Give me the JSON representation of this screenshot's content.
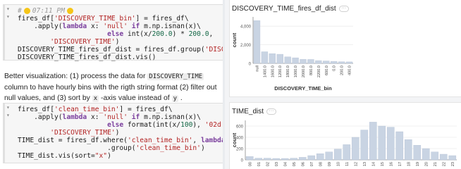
{
  "cell1": {
    "comment_time": "07:11 PM",
    "lines": [
      [
        "fires_df[",
        {
          "s": "'DISCOVERY_TIME_bin'"
        },
        "] = fires_df\\"
      ],
      [
        "    .apply(",
        {
          "k": "lambda"
        },
        " x: ",
        {
          "s": "'null'"
        },
        " ",
        {
          "k": "if"
        },
        " m.np.isnan(x)\\"
      ],
      [
        "                      ",
        {
          "k": "else"
        },
        " int(x/",
        {
          "n": "200.0"
        },
        ") * ",
        {
          "n": "200.0"
        },
        ","
      ],
      [
        "        ",
        {
          "s": "'DISCOVERY_TIME'"
        },
        ")"
      ],
      [
        "DISCOVERY_TIME_fires_df_dist = fires_df.group(",
        {
          "s": "'DISCOVERY"
        }
      ],
      [
        "DISCOVERY_TIME_fires_df_dist.vis()"
      ]
    ]
  },
  "markdown": {
    "t1": "Better visualization: (1) process the data for ",
    "c1": "DISCOVERY_TIME",
    "t2": " column to have hourly bins with the rigth string format (2) filter out null values, and (3) sort by ",
    "c2": "x",
    "t3": " -axis value instead of ",
    "c3": "y",
    "t4": " ."
  },
  "cell2": {
    "lines": [
      [
        "fires_df[",
        {
          "s": "'clean_time_bin'"
        },
        "] = fires_df\\"
      ],
      [
        "    .apply(",
        {
          "k": "lambda"
        },
        " x: ",
        {
          "s": "'null'"
        },
        " ",
        {
          "k": "if"
        },
        " m.np.isnan(x)\\"
      ],
      [
        "                      ",
        {
          "k": "else"
        },
        " format(int(x/",
        {
          "n": "100"
        },
        "), ",
        {
          "s": "'02d"
        }
      ],
      [
        "        ",
        {
          "s": "'DISCOVERY_TIME'"
        },
        ")"
      ],
      [
        "TIME_dist = fires_df.where(",
        {
          "s": "'clean_time_bin'"
        },
        ", ",
        {
          "k": "lambda"
        },
        " x: x"
      ],
      [
        "                      .group(",
        {
          "s": "'clean_time_bin'"
        },
        ")"
      ],
      [
        "TIME_dist.vis(sort=",
        {
          "s": "\"x\""
        },
        ")"
      ]
    ]
  },
  "charts": {
    "more_label": "···"
  },
  "colors": {
    "bar": "#c9d4e3",
    "bar_stroke": "#b6c3d6",
    "axis": "#888888"
  },
  "chart_data": [
    {
      "type": "bar",
      "title": "DISCOVERY_TIME_fires_df_dist",
      "xlabel": "DISCOVERY_TIME_bin",
      "ylabel": "count",
      "ylim": [
        0,
        5000
      ],
      "yticks": [
        0,
        2000,
        4000
      ],
      "ytick_labels": [
        "0",
        "2,000",
        "4,000"
      ],
      "categories": [
        "null",
        "1400.0",
        "1600.0",
        "1200.0",
        "1800.0",
        "1000.0",
        "2000.0",
        "800.0",
        "2200.0",
        "600.0",
        "0.0",
        "200.0",
        "400.0"
      ],
      "values": [
        4600,
        1250,
        1050,
        980,
        700,
        600,
        430,
        420,
        300,
        260,
        220,
        180,
        160
      ],
      "grid": true
    },
    {
      "type": "bar",
      "title": "TIME_dist",
      "xlabel": "",
      "ylabel": "count",
      "ylim": [
        0,
        700
      ],
      "yticks": [
        0,
        200,
        400,
        600
      ],
      "ytick_labels": [
        "0",
        "200",
        "400",
        "600"
      ],
      "categories": [
        "00",
        "01",
        "02",
        "03",
        "04",
        "05",
        "06",
        "07",
        "08",
        "09",
        "10",
        "11",
        "12",
        "13",
        "14",
        "15",
        "16",
        "17",
        "18",
        "19",
        "20",
        "21",
        "22",
        "23"
      ],
      "values": [
        60,
        30,
        30,
        25,
        25,
        30,
        45,
        75,
        110,
        140,
        190,
        270,
        400,
        530,
        670,
        600,
        580,
        500,
        360,
        260,
        200,
        140,
        100,
        75
      ],
      "grid": true
    }
  ]
}
